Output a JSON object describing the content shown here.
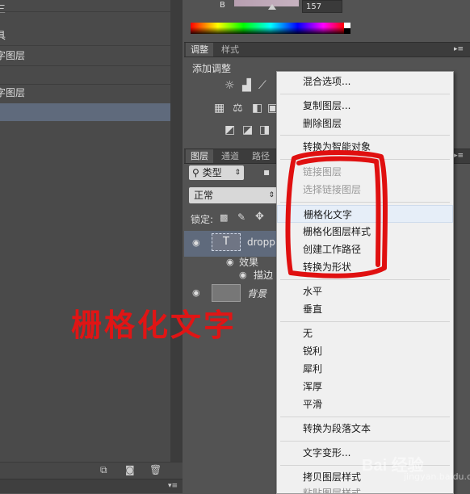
{
  "history": {
    "items": [
      {
        "label": "具"
      },
      {
        "label": "字图层"
      },
      {
        "label": "字图层"
      }
    ]
  },
  "color_panel": {
    "channel_label": "B",
    "channel_value": "157"
  },
  "adjustments": {
    "tabs": [
      {
        "label": "调整"
      },
      {
        "label": "样式"
      }
    ],
    "title": "添加调整",
    "icons": [
      "brightness-icon",
      "levels-icon",
      "curves-icon",
      "exposure-icon",
      "vibrance-icon",
      "hue-saturation-icon",
      "color-balance-icon",
      "black-white-icon",
      "photo-filter-icon",
      "channel-mixer-icon",
      "invert-icon",
      "posterize-icon"
    ]
  },
  "layers": {
    "tabs": [
      {
        "label": "图层"
      },
      {
        "label": "通道"
      },
      {
        "label": "路径"
      }
    ],
    "filter_value": "类型",
    "blend_mode": "正常",
    "lock_label": "锁定:",
    "rows": [
      {
        "name": "droppi",
        "thumb": "T"
      },
      {
        "name": "效果"
      },
      {
        "name": "描边"
      },
      {
        "name": "背景"
      }
    ]
  },
  "context_menu": {
    "items": [
      {
        "label": "混合选项...",
        "state": "normal"
      },
      {
        "label": "复制图层...",
        "state": "normal"
      },
      {
        "label": "删除图层",
        "state": "normal"
      },
      {
        "label": "转换为智能对象",
        "state": "normal"
      },
      {
        "label": "链接图层",
        "state": "disabled"
      },
      {
        "label": "选择链接图层",
        "state": "disabled"
      },
      {
        "label": "栅格化文字",
        "state": "hover"
      },
      {
        "label": "栅格化图层样式",
        "state": "normal"
      },
      {
        "label": "创建工作路径",
        "state": "normal"
      },
      {
        "label": "转换为形状",
        "state": "normal"
      },
      {
        "label": "水平",
        "state": "normal"
      },
      {
        "label": "垂直",
        "state": "normal"
      },
      {
        "label": "无",
        "state": "normal"
      },
      {
        "label": "锐利",
        "state": "normal"
      },
      {
        "label": "犀利",
        "state": "normal"
      },
      {
        "label": "浑厚",
        "state": "normal"
      },
      {
        "label": "平滑",
        "state": "normal"
      },
      {
        "label": "转换为段落文本",
        "state": "normal"
      },
      {
        "label": "文字变形...",
        "state": "normal"
      },
      {
        "label": "拷贝图层样式",
        "state": "normal"
      },
      {
        "label": "粘贴图层样式",
        "state": "normal"
      }
    ]
  },
  "annotation": {
    "text": "栅格化文字",
    "color": "#e01515"
  },
  "watermark": {
    "text": "Bai 经验",
    "sub": "jingyan.baidu.com"
  }
}
